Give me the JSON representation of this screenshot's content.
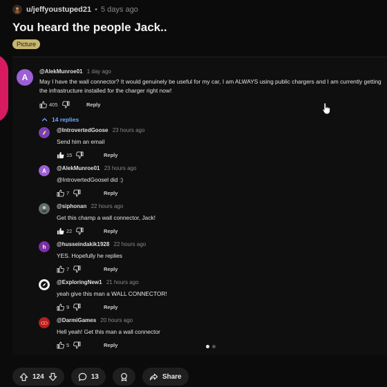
{
  "post": {
    "author": "u/jeffyoustuped21",
    "age": "5 days ago",
    "title": "You heard the people Jack..",
    "flair": "Picture"
  },
  "main_comment": {
    "avatar_letter": "A",
    "avatar_color": "#9c5fd6",
    "handle": "@AlekMunroe01",
    "age": "1 day ago",
    "text": "May I have the wall connector? It would genuinely be useful for my car, I am ALWAYS using public chargers and I am currently getting the infrastructure installed for the charger right now!",
    "likes": "405",
    "reply_label": "Reply",
    "replies_toggle": "14 replies"
  },
  "replies": [
    {
      "handle": "@IntrovertedGoose",
      "age": "23 hours ago",
      "text": "Send him an email",
      "likes": "15",
      "reply_label": "Reply",
      "avatar_icon": "goose-avatar-icon",
      "avatar_color": "#7a3fb5"
    },
    {
      "handle": "@AlekMunroe01",
      "age": "23 hours ago",
      "text": "@IntrovertedGoosel did :)",
      "likes": "7",
      "reply_label": "Reply",
      "avatar_letter": "A",
      "avatar_color": "#9c5fd6"
    },
    {
      "handle": "@siphonan",
      "age": "22 hours ago",
      "text": "Get this champ a wall connector, Jack!",
      "likes": "22",
      "reply_label": "Reply",
      "avatar_icon": "photo-avatar-icon",
      "avatar_color": "#5e6f6a"
    },
    {
      "handle": "@husseindakik1928",
      "age": "22 hours ago",
      "text": "YES. Hopefully he replies",
      "likes": "7",
      "reply_label": "Reply",
      "avatar_letter": "h",
      "avatar_color": "#7b2fa6"
    },
    {
      "handle": "@ExploringNew1",
      "age": "21 hours ago",
      "text": "yeah give this man a WALL CONNECTOR!",
      "likes": "9",
      "reply_label": "Reply",
      "avatar_icon": "compass-avatar-icon",
      "avatar_color": "#f2f2f2"
    },
    {
      "handle": "@DarmiGames",
      "age": "20 hours ago",
      "text": "Hell yeah! Get this man a wall connector",
      "likes": "5",
      "reply_label": "Reply",
      "avatar_icon": "game-avatar-icon",
      "avatar_color": "#b52020"
    }
  ],
  "bottom_bar": {
    "upvotes": "124",
    "comments": "13",
    "share_label": "Share"
  },
  "colors": {
    "accent_blue": "#6ea8ff",
    "flair_bg": "#c9b66e",
    "brand_pink": "#d81b60"
  }
}
